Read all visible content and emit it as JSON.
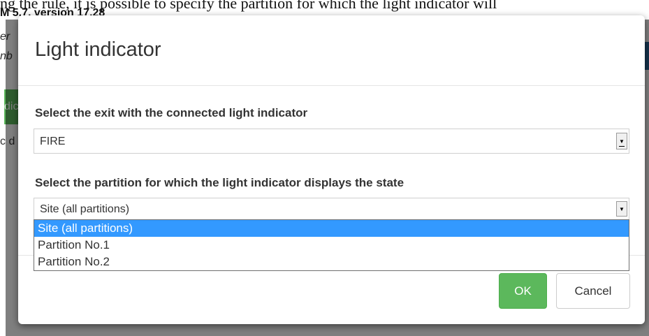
{
  "background": {
    "top_line": "ng the rule, it is possible to specify the partition for which the light indicator will",
    "version_text": "M 5.7, version 17.28",
    "fragments": [
      "er",
      "nb",
      "dic",
      "c d"
    ]
  },
  "modal": {
    "title": "Light indicator",
    "exit_field": {
      "label": "Select the exit with the connected light indicator",
      "value": "FIRE"
    },
    "partition_field": {
      "label": "Select the partition for which the light indicator displays the state",
      "value": "Site (all partitions)",
      "options": [
        "Site (all partitions)",
        "Partition No.1",
        "Partition No.2"
      ],
      "highlighted_option": "Site (all partitions)"
    },
    "buttons": {
      "ok": "OK",
      "cancel": "Cancel"
    }
  },
  "colors": {
    "backdrop": "#000000",
    "ok_button": "#5cb85c",
    "highlight": "#3399ff",
    "side_button": "#5cb85c",
    "side_blue": "#2a6496"
  },
  "icons": {
    "dropdown_arrow": "triangle-down-icon"
  }
}
